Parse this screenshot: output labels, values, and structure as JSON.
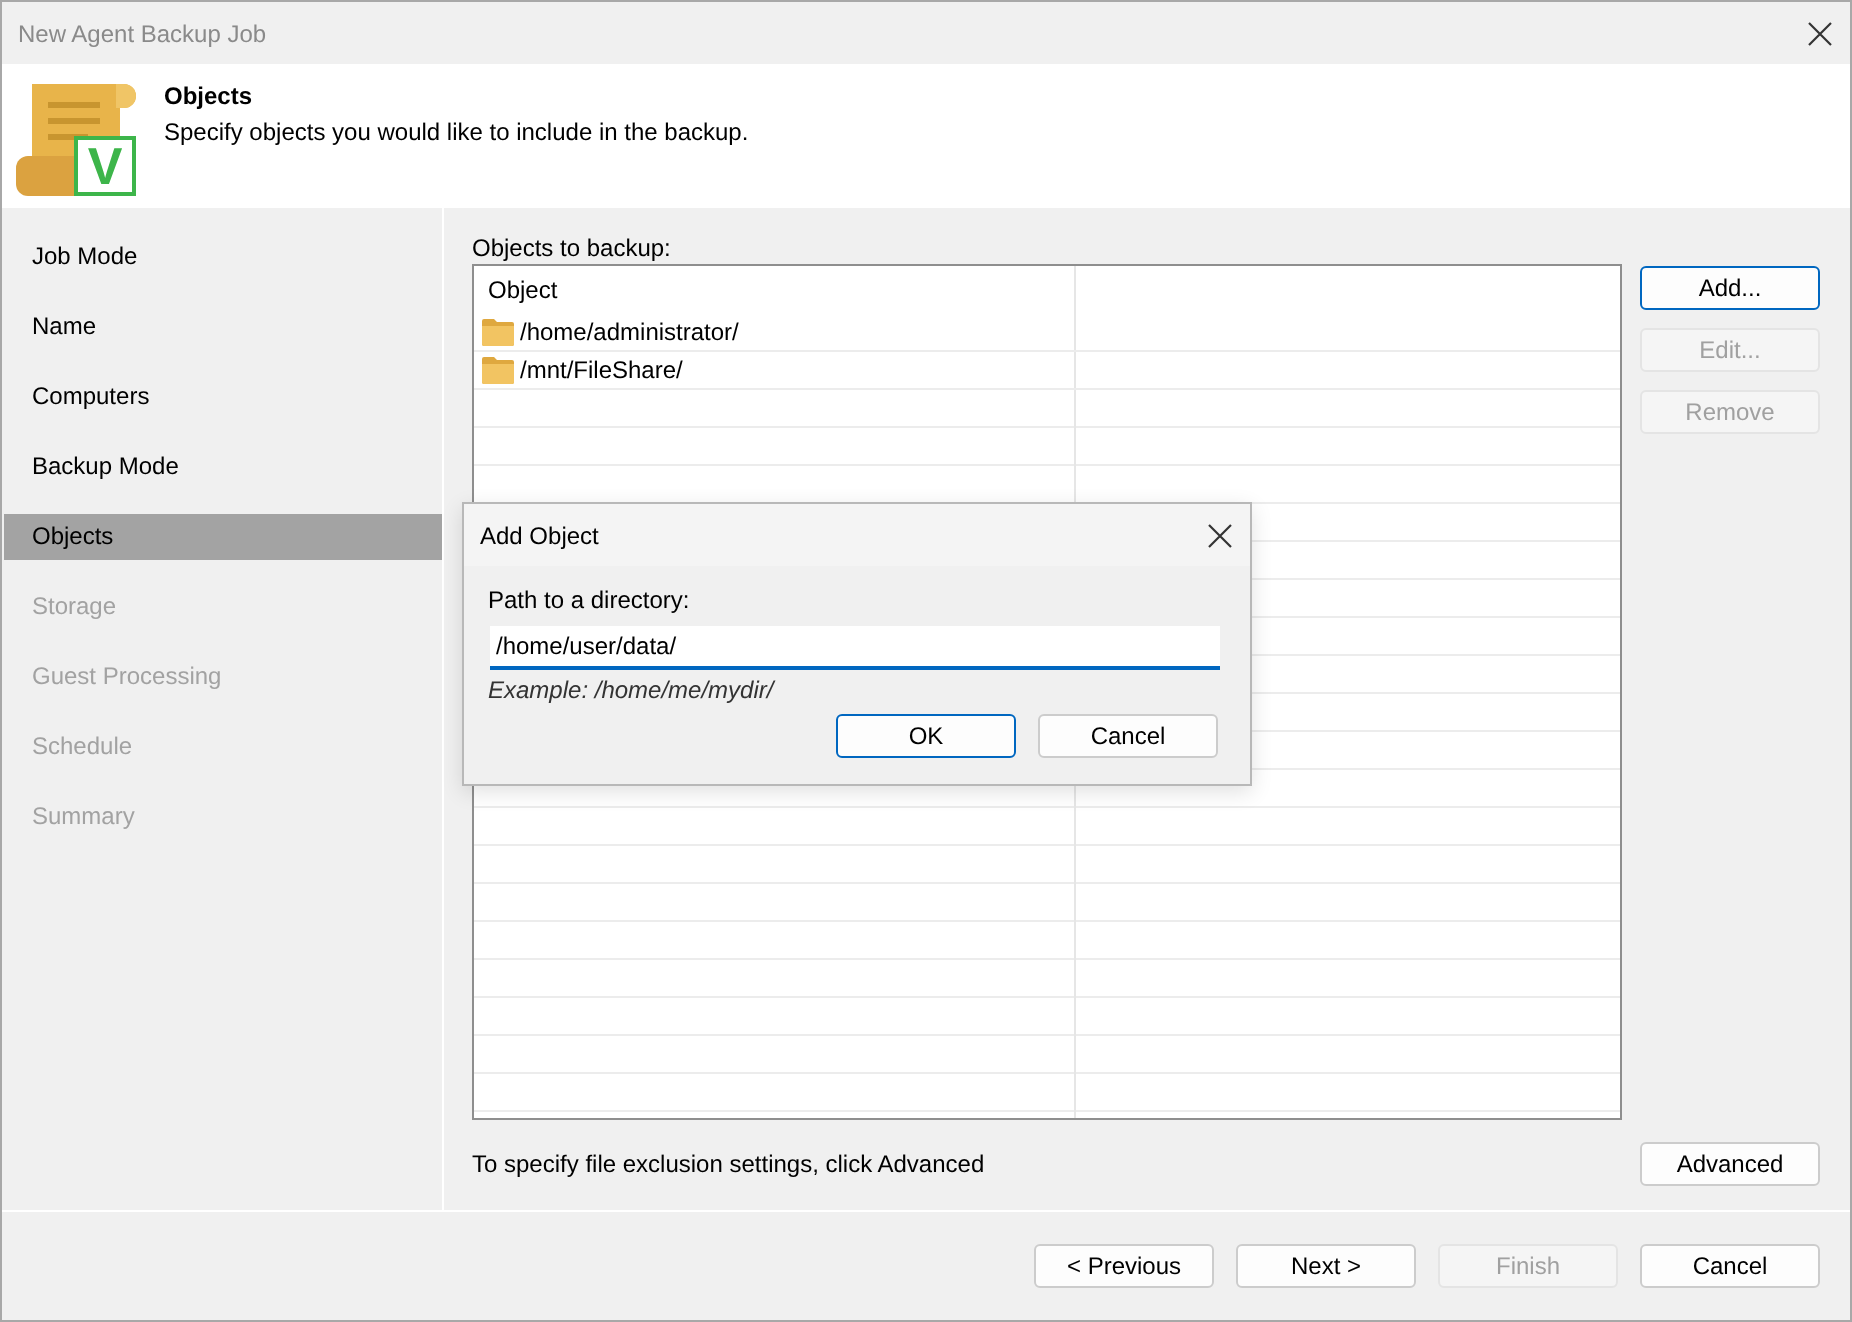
{
  "window": {
    "title": "New Agent Backup Job"
  },
  "header": {
    "title": "Objects",
    "subtitle": "Specify objects you would like to include in the backup.",
    "badge": "V"
  },
  "steps": [
    {
      "label": "Job Mode",
      "selected": false,
      "disabled": false
    },
    {
      "label": "Name",
      "selected": false,
      "disabled": false
    },
    {
      "label": "Computers",
      "selected": false,
      "disabled": false
    },
    {
      "label": "Backup Mode",
      "selected": false,
      "disabled": false
    },
    {
      "label": "Objects",
      "selected": true,
      "disabled": false
    },
    {
      "label": "Storage",
      "selected": false,
      "disabled": true
    },
    {
      "label": "Guest Processing",
      "selected": false,
      "disabled": true
    },
    {
      "label": "Schedule",
      "selected": false,
      "disabled": true
    },
    {
      "label": "Summary",
      "selected": false,
      "disabled": true
    }
  ],
  "objects": {
    "label": "Objects to backup:",
    "columns": [
      "Object"
    ],
    "rows": [
      {
        "object": "/home/administrator/"
      },
      {
        "object": "/mnt/FileShare/"
      }
    ]
  },
  "side_buttons": [
    {
      "label": "Add...",
      "focused": true,
      "disabled": false
    },
    {
      "label": "Edit...",
      "focused": false,
      "disabled": true
    },
    {
      "label": "Remove",
      "focused": false,
      "disabled": true
    }
  ],
  "exclusion_hint": "To specify file exclusion settings, click Advanced",
  "advanced_button": {
    "label": "Advanced"
  },
  "footer_buttons": [
    {
      "label": "< Previous",
      "disabled": false
    },
    {
      "label": "Next >",
      "disabled": false
    },
    {
      "label": "Finish",
      "disabled": true
    },
    {
      "label": "Cancel",
      "disabled": false
    }
  ],
  "dialog": {
    "title": "Add Object",
    "field_label": "Path to a directory:",
    "value": "/home/user/data/",
    "example": "Example: /home/me/mydir/",
    "buttons": [
      {
        "label": "OK",
        "focused": true
      },
      {
        "label": "Cancel",
        "focused": false
      }
    ]
  }
}
